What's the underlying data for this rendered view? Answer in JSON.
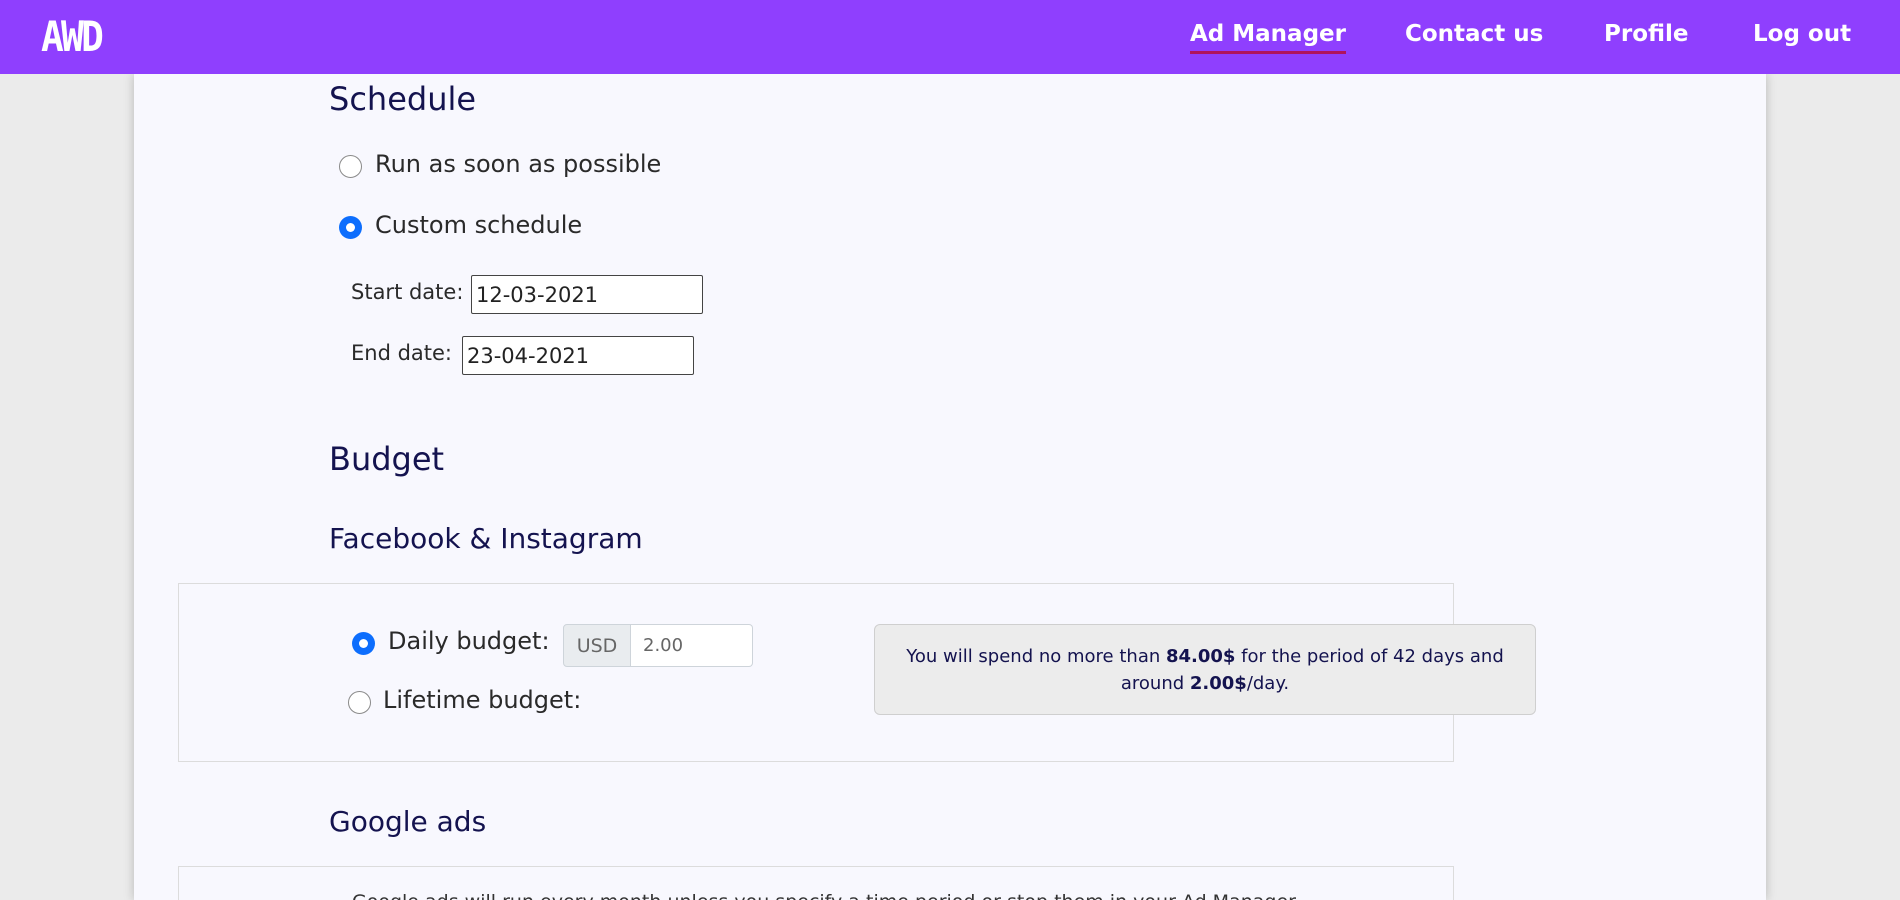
{
  "nav": {
    "logo": "AWD",
    "links": {
      "ad_manager": "Ad Manager",
      "contact": "Contact us",
      "profile": "Profile",
      "logout": "Log out"
    }
  },
  "schedule": {
    "heading": "Schedule",
    "option_asap": "Run as soon as possible",
    "option_custom": "Custom schedule",
    "selected": "custom",
    "start_label": "Start date:",
    "start_value": "12-03-2021",
    "end_label": "End date:",
    "end_value": "23-04-2021"
  },
  "budget": {
    "heading": "Budget",
    "facebook": {
      "heading": "Facebook & Instagram",
      "daily_label": "Daily budget:",
      "lifetime_label": "Lifetime budget:",
      "selected": "daily",
      "currency": "USD",
      "amount": "2.00",
      "info": {
        "p1": "You will spend no more than ",
        "total": "84.00$",
        "p2": " for the period of 42 days and",
        "p3": "around ",
        "daily": "2.00$",
        "p4": "/day."
      }
    },
    "google": {
      "heading": "Google ads",
      "note": "Google ads will run every month unless you specify a time period or stop them in your Ad Manager."
    }
  },
  "colors": {
    "nav_bg": "#8f3ffe",
    "active_underline": "#b0135d",
    "heading": "#14134f",
    "radio_checked": "#0d6efd"
  }
}
